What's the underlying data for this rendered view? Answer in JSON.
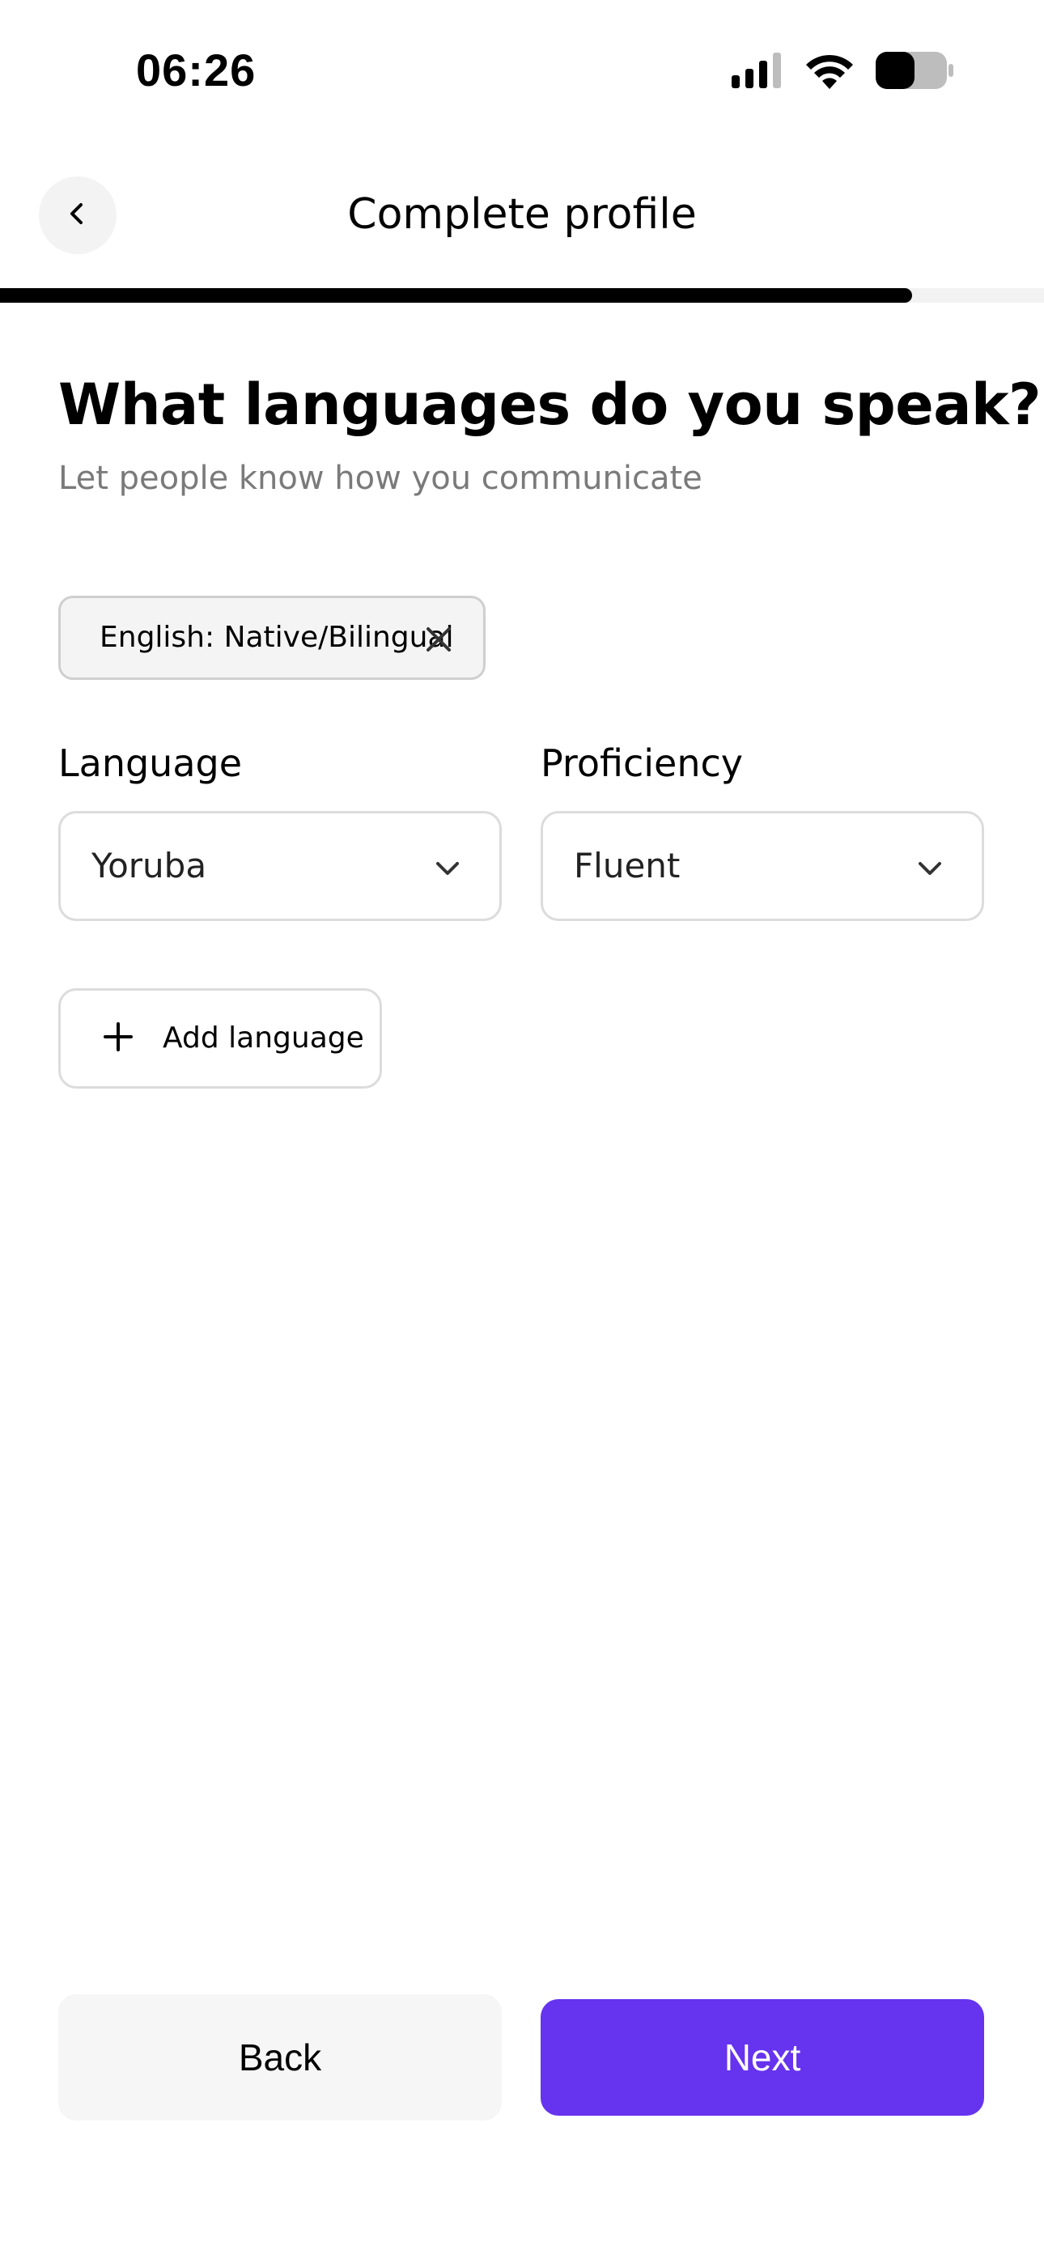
{
  "status_bar": {
    "time": "06:26",
    "signal_icon": "cellular-signal-icon",
    "wifi_icon": "wifi-icon",
    "battery_icon": "battery-icon",
    "battery_level": 0.55
  },
  "header": {
    "back_icon": "chevron-left-icon",
    "title": "Complete profile"
  },
  "progress": {
    "fraction": 0.874
  },
  "question": {
    "title": "What languages do you speak?",
    "subtitle": "Let people know how you communicate"
  },
  "selected_languages": [
    {
      "label": "English: Native/Bilingual",
      "remove_icon": "close-icon"
    }
  ],
  "form": {
    "language": {
      "label": "Language",
      "value": "Yoruba",
      "icon": "chevron-down-icon"
    },
    "proficiency": {
      "label": "Proficiency",
      "value": "Fluent",
      "icon": "chevron-down-icon"
    },
    "add_button": {
      "label": "Add language",
      "icon": "plus-icon"
    }
  },
  "footer": {
    "back_label": "Back",
    "next_label": "Next"
  },
  "colors": {
    "accent": "#6633EE",
    "progress_fill": "#000000",
    "progress_track": "#F2F2F2",
    "subtitle_text": "#7A7A7A",
    "back_button_bg": "#F6F6F6"
  }
}
